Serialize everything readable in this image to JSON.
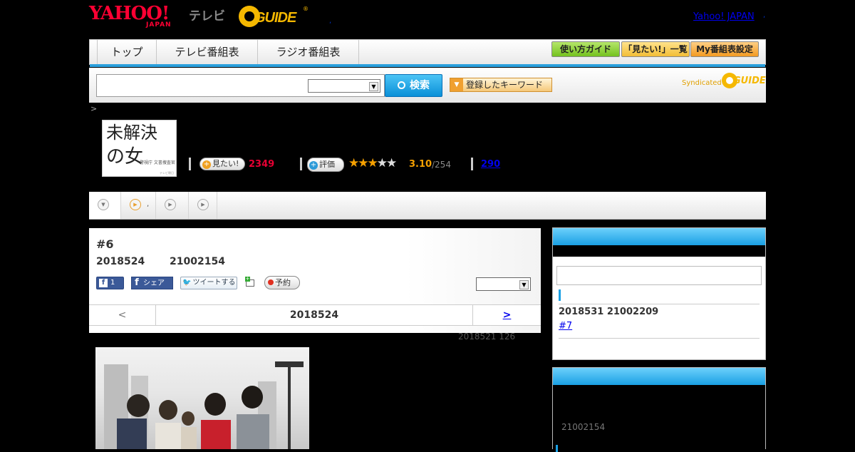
{
  "header": {
    "yahoo_logo": "YAHOO!",
    "japan_logo": "JAPAN",
    "tv_label": "テレビ",
    "gguide_logo": "GUIDE",
    "gguide_reg": "®",
    "dot1": ",",
    "yahoo_japan_link": "Yahoo! JAPAN",
    "dot2": ","
  },
  "nav": {
    "tabs": [
      "トップ",
      "テレビ番組表",
      "ラジオ番組表"
    ],
    "guide_button": "使い方ガイド",
    "mitai_list_button": "「見たい!」一覧",
    "my_schedule_button": "My番組表設定"
  },
  "search": {
    "input_value": "",
    "select_value": "",
    "button_label": "検索",
    "keyword_button": "登録したキーワード",
    "syndicated": "Syndicated",
    "syndicated_logo": "GUIDE"
  },
  "breadcrumb": ">",
  "program": {
    "poster_line1": "未解決",
    "poster_line2": "の女",
    "poster_line3": "警視庁\n文書捜査官",
    "poster_line4": "テレビ朝日",
    "mitai_button": "見たい!",
    "mitai_count": "2349",
    "hyoka_button": "評価",
    "stars_filled": 3,
    "stars_total": 5,
    "rating": "3.10",
    "rating_count": "/254",
    "review_count": "290"
  },
  "tabs": {
    "tab2_text": ","
  },
  "episode": {
    "title": "#6",
    "date": "2018524",
    "time": "21002154",
    "fb_like_count": "1",
    "fb_share": "シェア",
    "tweet": "ツイートする",
    "yoyaku": "予約",
    "select_value": "",
    "prev": "<",
    "nav_date": "2018524",
    "next": ">",
    "updated": "2018521  126"
  },
  "sidebar": {
    "next_date": "2018531  21002209",
    "next_episode": "#7",
    "time2": "21002154"
  }
}
